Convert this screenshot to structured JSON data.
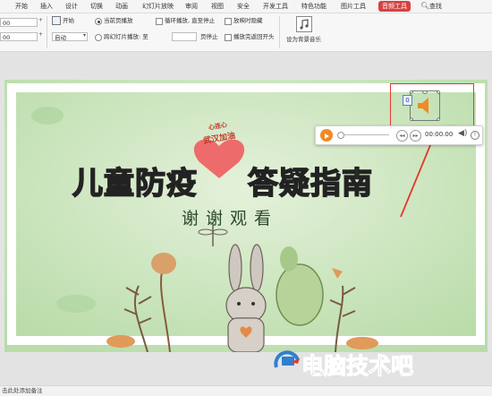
{
  "ribbon_tabs": [
    "开始",
    "插入",
    "设计",
    "切换",
    "动画",
    "幻灯片放映",
    "审阅",
    "视图",
    "安全",
    "开发工具",
    "特色功能",
    "图片工具",
    "音频工具"
  ],
  "active_tab": "音频工具",
  "search_label": "查找",
  "ribbon": {
    "value1": "00",
    "value2": "00",
    "start_label": "开始",
    "start_value": "自动",
    "current_page_label": "当前页播放",
    "cross_slide_label": "跨幻灯片播放: 至",
    "page_stop_label": "页停止",
    "loop_label": "循环播放, 直至停止",
    "rewind_label": "播放完返回开头",
    "hide_label": "放映时隐藏",
    "set_bg_music_label": "设为背景音乐"
  },
  "slide": {
    "title_part1": "儿童防疫",
    "title_part2": "答疑指南",
    "subtitle": "谢谢观看",
    "badge_text_top": "心连心",
    "badge_text_bottom": "武汉加油"
  },
  "audio_player": {
    "time": "00:00.00",
    "badge_number": "0"
  },
  "status_bar": {
    "text": "击此处添加备注"
  },
  "watermark": "电脑技术吧",
  "colors": {
    "active_tab": "#d64242",
    "highlight_box": "#e2382d",
    "play_button": "#f08a24",
    "title_red": "#e8322f",
    "title_green": "#28a34a",
    "title_blue": "#1f6fd0",
    "title_yellow": "#f4b81a"
  }
}
